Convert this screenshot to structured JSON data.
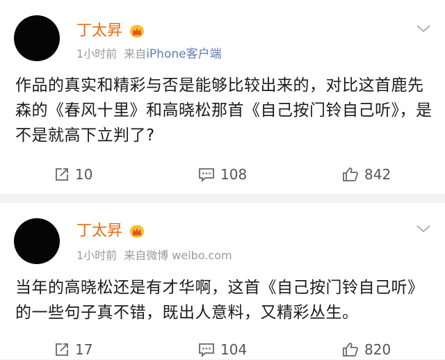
{
  "posts": [
    {
      "username": "丁太昇",
      "time": "1小时前",
      "source_prefix": "来自",
      "source_app": "iPhone客户端",
      "text": "作品的真实和精彩与否是能够比较出来的，对比这首鹿先森的《春风十里》和高晓松那首《自己按门铃自己听》，是不是就高下立判了?",
      "reposts": "10",
      "comments": "108",
      "likes": "842"
    },
    {
      "username": "丁太昇",
      "time": "1小时前",
      "source_prefix": "来自微博",
      "source_app": "weibo.com",
      "text": "当年的高晓松还是有才华啊，这首《自己按门铃自己听》的一些句子真不错，既出人意料，又精彩丛生。",
      "reposts": "17",
      "comments": "104",
      "likes": "820"
    }
  ],
  "colors": {
    "username": "#e86b11",
    "meta": "#999999",
    "source_link": "#5b7fad",
    "text": "#1a1a1a",
    "background": "#f2f2f2"
  },
  "icons": {
    "badge": "vip-crown-icon",
    "menu": "chevron-down-icon",
    "repost": "repost-icon",
    "comment": "comment-icon",
    "like": "thumbs-up-icon"
  }
}
